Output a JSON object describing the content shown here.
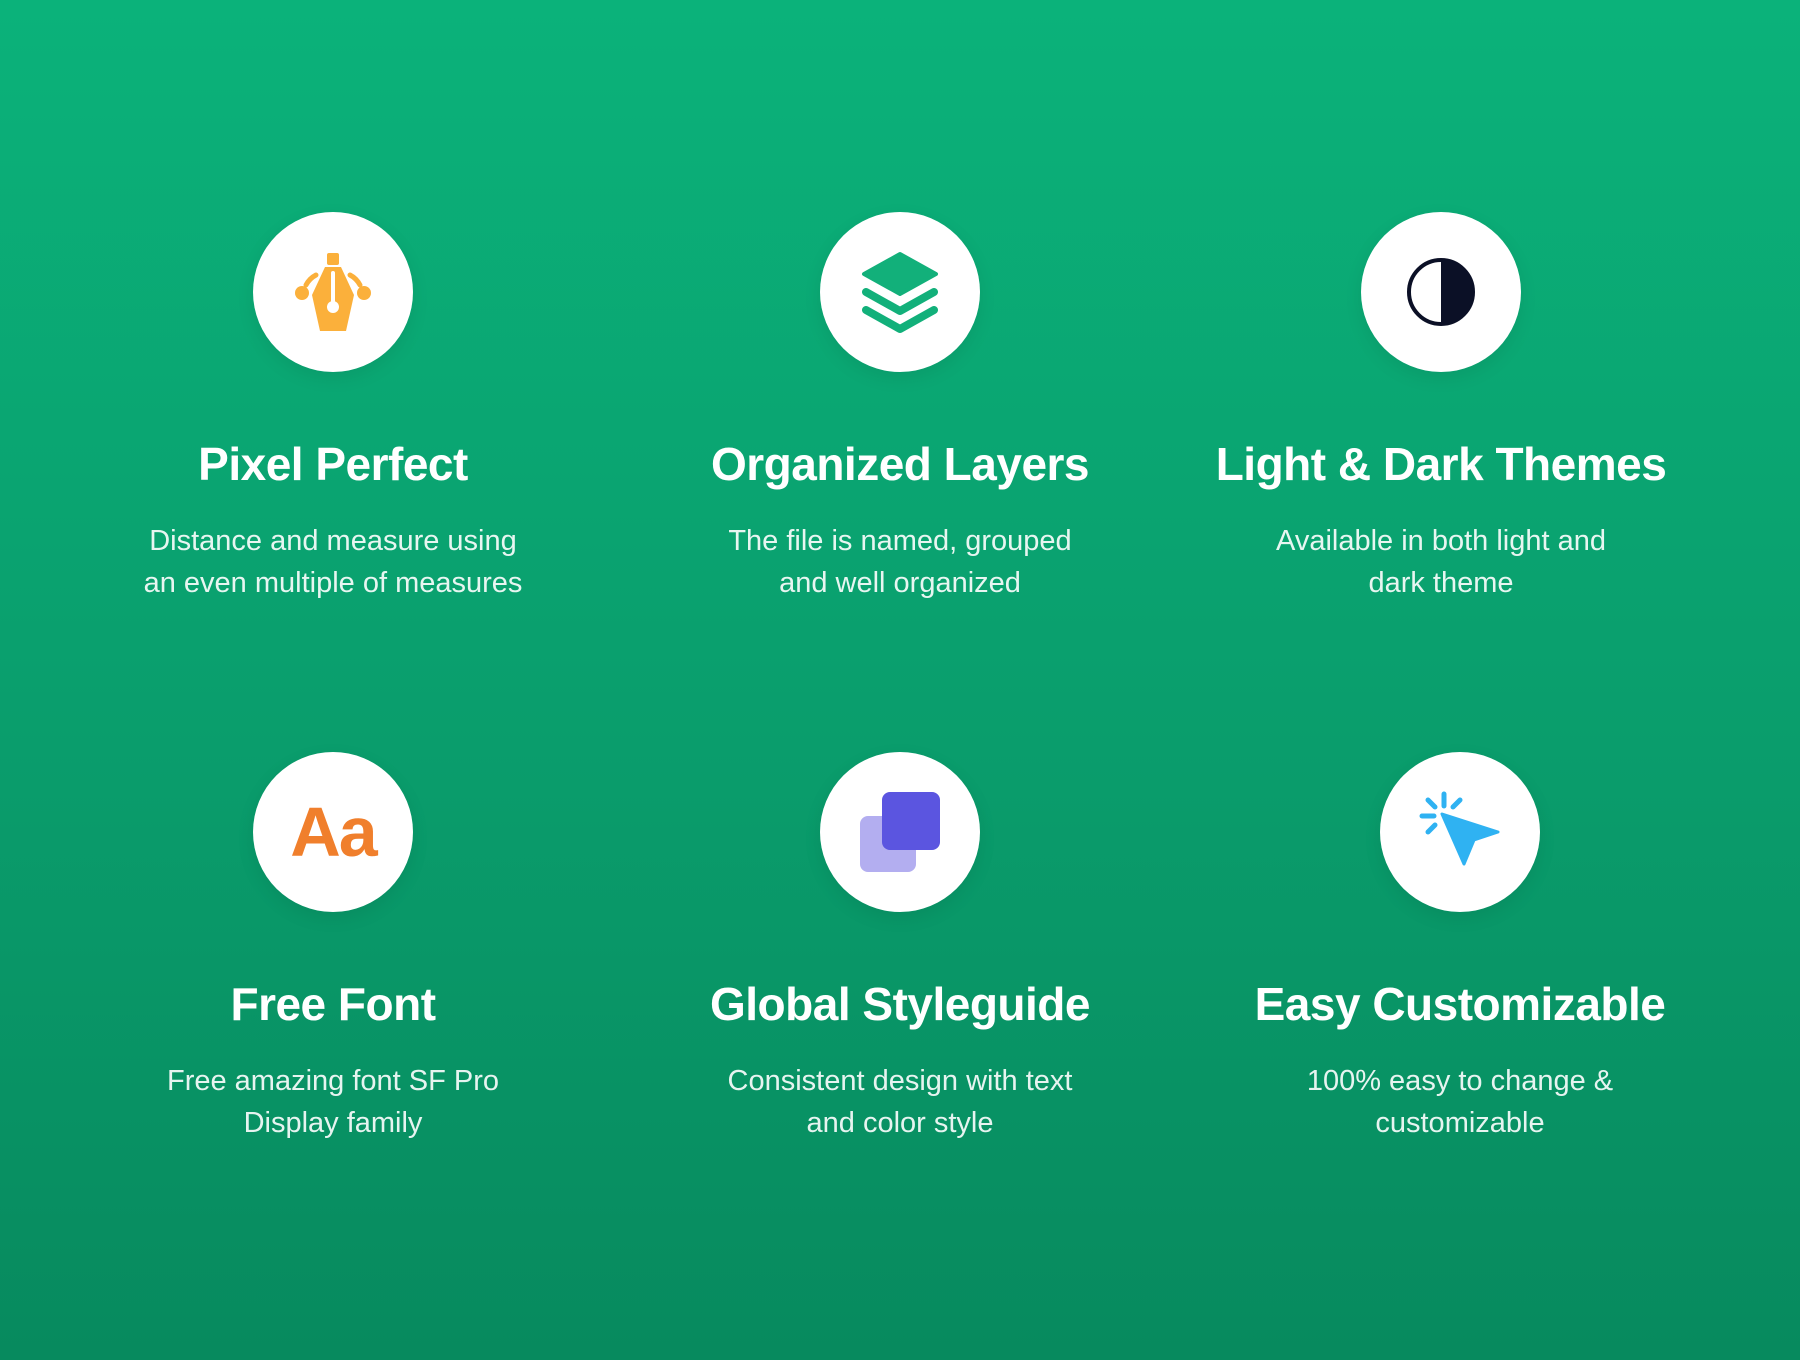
{
  "colors": {
    "background_top": "#0bb27a",
    "background_bottom": "#078a5e",
    "circle": "#ffffff",
    "pen_icon": "#fbb03b",
    "layers_icon": "#12b07a",
    "theme_icon": "#0b1026",
    "font_icon": "#f07f2c",
    "styleguide_front": "#5b55e0",
    "styleguide_back": "#b3aef0",
    "cursor_icon": "#2fb2f2"
  },
  "features": [
    {
      "icon": "pen-tool-icon",
      "title": "Pixel Perfect",
      "desc_line1": "Distance and measure using",
      "desc_line2": "an even multiple of measures"
    },
    {
      "icon": "layers-icon",
      "title": "Organized Layers",
      "desc_line1": "The file is named, grouped",
      "desc_line2": "and well organized"
    },
    {
      "icon": "half-circle-theme-icon",
      "title": "Light & Dark Themes",
      "desc_line1": "Available in both light and",
      "desc_line2": "dark theme"
    },
    {
      "icon": "font-icon",
      "icon_text": "Aa",
      "title": "Free Font",
      "desc_line1": "Free amazing font SF Pro",
      "desc_line2": "Display family"
    },
    {
      "icon": "styleguide-squares-icon",
      "title": "Global Styleguide",
      "desc_line1": "Consistent design with text",
      "desc_line2": "and color style"
    },
    {
      "icon": "cursor-click-icon",
      "title": "Easy Customizable",
      "desc_line1": "100% easy to change &",
      "desc_line2": "customizable"
    }
  ]
}
